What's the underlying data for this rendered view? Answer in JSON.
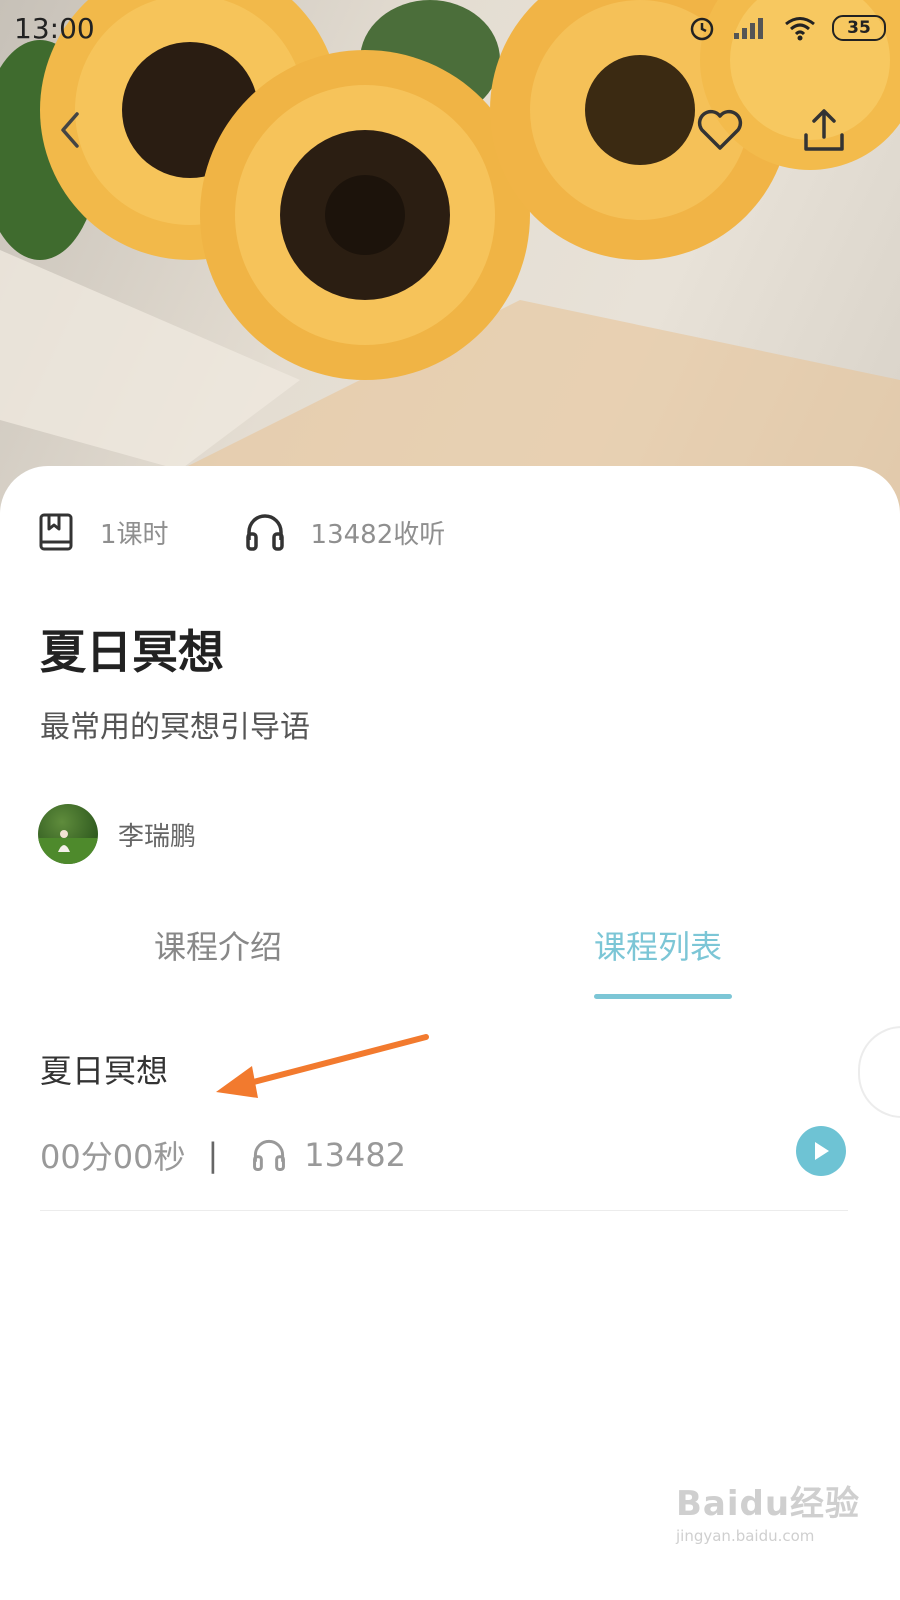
{
  "status_bar": {
    "time": "13:00",
    "battery": "35"
  },
  "course": {
    "lessons_count": "1课时",
    "listens": "13482收听",
    "title": "夏日冥想",
    "subtitle": "最常用的冥想引导语",
    "author": "李瑞鹏"
  },
  "tabs": [
    {
      "label": "课程介绍",
      "active": false
    },
    {
      "label": "课程列表",
      "active": true
    }
  ],
  "lesson": {
    "title": "夏日冥想",
    "duration": "00分00秒",
    "separator": "|",
    "listens": "13482"
  },
  "colors": {
    "accent": "#7cc6d6",
    "annotation_arrow": "#f27a2e"
  },
  "watermark": {
    "main": "Baidu经验",
    "url": "jingyan.baidu.com"
  }
}
